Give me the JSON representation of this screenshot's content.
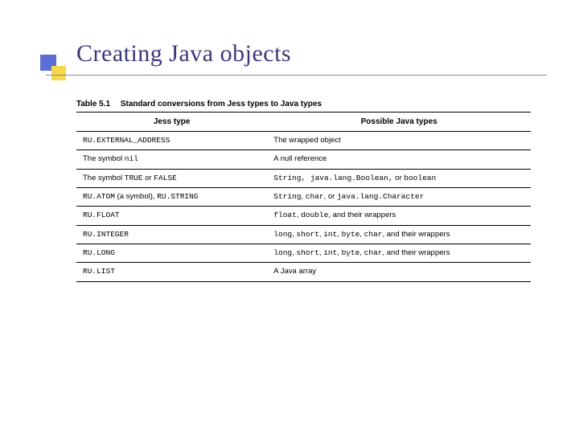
{
  "title": "Creating Java objects",
  "table": {
    "label": "Table 5.1",
    "caption": "Standard conversions from Jess types to Java types",
    "headers": [
      "Jess type",
      "Possible Java types"
    ],
    "rows": [
      {
        "c1_parts": [
          {
            "t": "RU.EXTERNAL_ADDRESS",
            "mono": true
          }
        ],
        "c2_parts": [
          {
            "t": "The wrapped object",
            "mono": false
          }
        ]
      },
      {
        "c1_parts": [
          {
            "t": "The symbol ",
            "mono": false
          },
          {
            "t": "nil",
            "mono": true
          }
        ],
        "c2_parts": [
          {
            "t": "A null reference",
            "mono": false
          }
        ]
      },
      {
        "c1_parts": [
          {
            "t": "The symbol ",
            "mono": false
          },
          {
            "t": "TRUE",
            "mono": true
          },
          {
            "t": " or ",
            "mono": false
          },
          {
            "t": "FALSE",
            "mono": true
          }
        ],
        "c2_parts": [
          {
            "t": "String, java.lang.Boolean,",
            "mono": true
          },
          {
            "t": " or ",
            "mono": false
          },
          {
            "t": "boolean",
            "mono": true
          }
        ]
      },
      {
        "c1_parts": [
          {
            "t": "RU.ATOM",
            "mono": true
          },
          {
            "t": " (a symbol), ",
            "mono": false
          },
          {
            "t": "RU.STRING",
            "mono": true
          }
        ],
        "c2_parts": [
          {
            "t": "String",
            "mono": true
          },
          {
            "t": ", ",
            "mono": false
          },
          {
            "t": "char",
            "mono": true
          },
          {
            "t": ", or ",
            "mono": false
          },
          {
            "t": "java.lang.Character",
            "mono": true
          }
        ]
      },
      {
        "c1_parts": [
          {
            "t": "RU.FLOAT",
            "mono": true
          }
        ],
        "c2_parts": [
          {
            "t": "float",
            "mono": true
          },
          {
            "t": ", ",
            "mono": false
          },
          {
            "t": "double",
            "mono": true
          },
          {
            "t": ", and their wrappers",
            "mono": false
          }
        ]
      },
      {
        "c1_parts": [
          {
            "t": "RU.INTEGER",
            "mono": true
          }
        ],
        "c2_parts": [
          {
            "t": "long",
            "mono": true
          },
          {
            "t": ", ",
            "mono": false
          },
          {
            "t": "short",
            "mono": true
          },
          {
            "t": ", ",
            "mono": false
          },
          {
            "t": "int",
            "mono": true
          },
          {
            "t": ", ",
            "mono": false
          },
          {
            "t": "byte",
            "mono": true
          },
          {
            "t": ", ",
            "mono": false
          },
          {
            "t": "char",
            "mono": true
          },
          {
            "t": ", and their wrappers",
            "mono": false
          }
        ]
      },
      {
        "c1_parts": [
          {
            "t": "RU.LONG",
            "mono": true
          }
        ],
        "c2_parts": [
          {
            "t": "long",
            "mono": true
          },
          {
            "t": ", ",
            "mono": false
          },
          {
            "t": "short",
            "mono": true
          },
          {
            "t": ", ",
            "mono": false
          },
          {
            "t": "int",
            "mono": true
          },
          {
            "t": ", ",
            "mono": false
          },
          {
            "t": "byte",
            "mono": true
          },
          {
            "t": ", ",
            "mono": false
          },
          {
            "t": "char",
            "mono": true
          },
          {
            "t": ", and their wrappers",
            "mono": false
          }
        ]
      },
      {
        "c1_parts": [
          {
            "t": "RU.LIST",
            "mono": true
          }
        ],
        "c2_parts": [
          {
            "t": "A Java array",
            "mono": false
          }
        ]
      }
    ]
  }
}
